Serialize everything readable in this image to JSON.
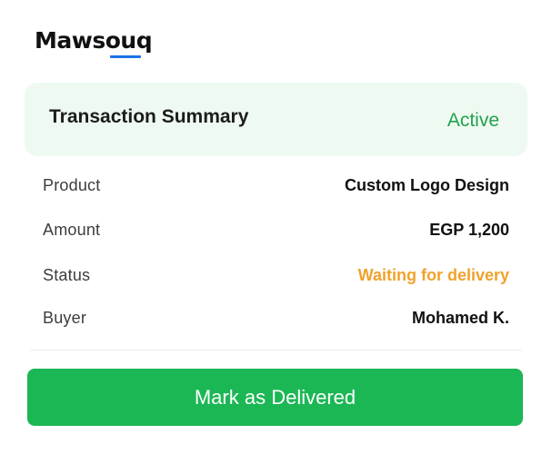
{
  "brand": {
    "name": "Mawsouq",
    "accent_color": "#1a73e8"
  },
  "summary": {
    "title": "Transaction Summary",
    "status": "Active",
    "status_color": "#22a24e",
    "background_color": "#eefaf1"
  },
  "details": [
    {
      "label": "Product",
      "value": "Custom Logo Design"
    },
    {
      "label": "Amount",
      "value": "EGP 1,200"
    },
    {
      "label": "Status",
      "value": "Waiting for delivery",
      "value_color": "#f0a22c"
    },
    {
      "label": "Buyer",
      "value": "Mohamed K."
    }
  ],
  "action": {
    "label": "Mark as Delivered",
    "color": "#1cb755"
  }
}
